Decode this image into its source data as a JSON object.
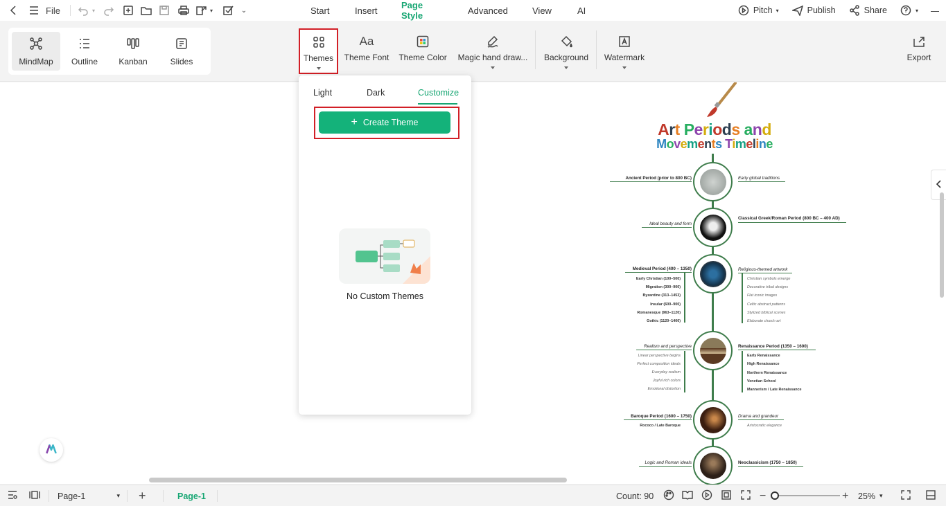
{
  "menubar": {
    "file_label": "File",
    "tabs": [
      {
        "label": "Start",
        "active": false
      },
      {
        "label": "Insert",
        "active": false
      },
      {
        "label": "Page Style",
        "active": true
      },
      {
        "label": "Advanced",
        "active": false
      },
      {
        "label": "View",
        "active": false
      },
      {
        "label": "AI",
        "active": false
      }
    ],
    "pitch_label": "Pitch",
    "publish_label": "Publish",
    "share_label": "Share"
  },
  "views": [
    {
      "label": "MindMap",
      "icon": "mindmap-icon",
      "active": true
    },
    {
      "label": "Outline",
      "icon": "outline-icon",
      "active": false
    },
    {
      "label": "Kanban",
      "icon": "kanban-icon",
      "active": false
    },
    {
      "label": "Slides",
      "icon": "slides-icon",
      "active": false
    }
  ],
  "tools": {
    "themes": "Themes",
    "theme_font": "Theme Font",
    "theme_color": "Theme Color",
    "magic": "Magic hand draw...",
    "background": "Background",
    "watermark": "Watermark",
    "export": "Export"
  },
  "themes_panel": {
    "tabs": [
      "Light",
      "Dark",
      "Customize"
    ],
    "active_tab": "Customize",
    "create_label": "Create Theme",
    "empty_label": "No Custom Themes"
  },
  "mindmap": {
    "title_line1": [
      "A",
      "r",
      "t",
      " ",
      "P",
      "e",
      "r",
      "i",
      "o",
      "d",
      "s",
      " ",
      "a",
      "n",
      "d"
    ],
    "title_line2": [
      "M",
      "o",
      "v",
      "e",
      "m",
      "e",
      "n",
      "t",
      "s",
      " ",
      "T",
      "i",
      "m",
      "e",
      "l",
      "i",
      "n",
      "e"
    ],
    "title_colors": [
      "#c0392b",
      "#2c3e50",
      "#e67e22",
      "#2e86c1",
      "#27ae60",
      "#8e44ad",
      "#d4ac0d",
      "#16a085"
    ],
    "nodes": [
      {
        "left": "Ancient Period (prior to 800 BC)",
        "right": "Early global traditions"
      },
      {
        "left": "Ideal beauty and form",
        "right": "Classical Greek/Roman Period (800 BC – 400 AD)"
      },
      {
        "left": "Medieval Period (400 – 1350)",
        "right": "Religious-themed artwork",
        "left_subs": [
          "Early Christian (100–500)",
          "Migration (300–900)",
          "Byzantine (313–1453)",
          "Insular (600–900)",
          "Romanesque (963–1120)",
          "Gothic (1120–1400)"
        ],
        "right_subs": [
          "Christian symbols emerge",
          "Decorative tribal designs",
          "Flat iconic images",
          "Celtic abstract patterns",
          "Stylized biblical scenes",
          "Elaborate church art"
        ]
      },
      {
        "left": "Realism and perspective",
        "right": "Renaissance Period (1350 – 1600)",
        "left_subs": [
          "Linear perspective begins",
          "Perfect composition ideals",
          "Everyday realism",
          "Joyful rich colors",
          "Emotional distortion"
        ],
        "right_subs": [
          "Early Renaissance",
          "High Renaissance",
          "Northern Renaissance",
          "Venetian School",
          "Mannerism / Late Renaissance"
        ]
      },
      {
        "left": "Baroque Period (1600 – 1750)",
        "right": "Drama and grandeur",
        "left_subs": [
          "Rococo / Late Baroque"
        ],
        "right_subs": [
          "Aristocratic elegance"
        ]
      },
      {
        "left": "Logic and Roman ideals",
        "right": "Neoclassicism (1750 – 1850)"
      }
    ]
  },
  "statusbar": {
    "page_select": "Page-1",
    "page_tab": "Page-1",
    "count_label": "Count: 90",
    "zoom": "25%"
  }
}
